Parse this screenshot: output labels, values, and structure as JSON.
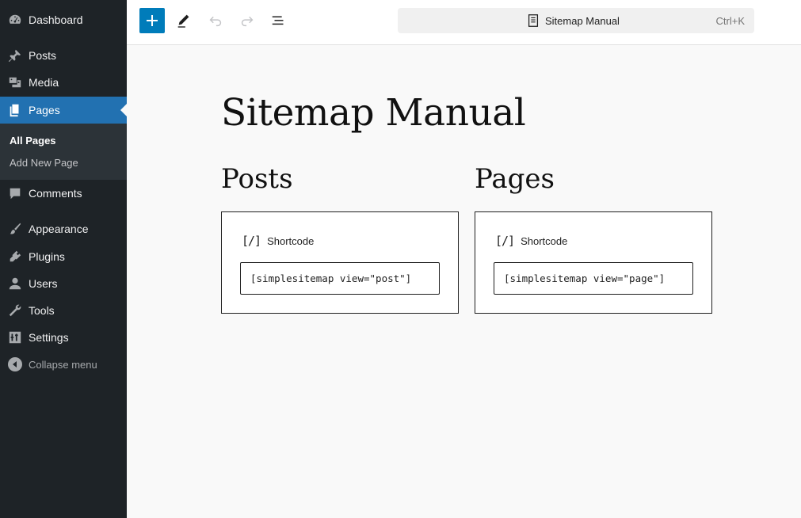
{
  "sidebar": {
    "items": [
      {
        "label": "Dashboard",
        "icon": "dashboard-icon"
      },
      {
        "label": "Posts",
        "icon": "pin-icon"
      },
      {
        "label": "Media",
        "icon": "media-icon"
      },
      {
        "label": "Pages",
        "icon": "pages-icon"
      },
      {
        "label": "Comments",
        "icon": "comment-icon"
      },
      {
        "label": "Appearance",
        "icon": "brush-icon"
      },
      {
        "label": "Plugins",
        "icon": "plugin-icon"
      },
      {
        "label": "Users",
        "icon": "user-icon"
      },
      {
        "label": "Tools",
        "icon": "wrench-icon"
      },
      {
        "label": "Settings",
        "icon": "settings-icon"
      }
    ],
    "submenu": [
      "All Pages",
      "Add New Page"
    ],
    "collapse_label": "Collapse menu",
    "active_item": "Pages"
  },
  "toolbar": {
    "document_title": "Sitemap Manual",
    "shortcut": "Ctrl+K",
    "icons": [
      "plus-icon",
      "pencil-icon",
      "undo-icon",
      "redo-icon",
      "list-view-icon"
    ]
  },
  "editor": {
    "title": "Sitemap Manual",
    "columns": [
      {
        "heading": "Posts",
        "block_label": "Shortcode",
        "shortcode": "[simplesitemap view=\"post\"]"
      },
      {
        "heading": "Pages",
        "block_label": "Shortcode",
        "shortcode": "[simplesitemap view=\"page\"]"
      }
    ]
  },
  "colors": {
    "sidebar_bg": "#1e2327",
    "active_bg": "#2271b1",
    "accent": "#007cba",
    "canvas_bg": "#f9f9f9"
  }
}
